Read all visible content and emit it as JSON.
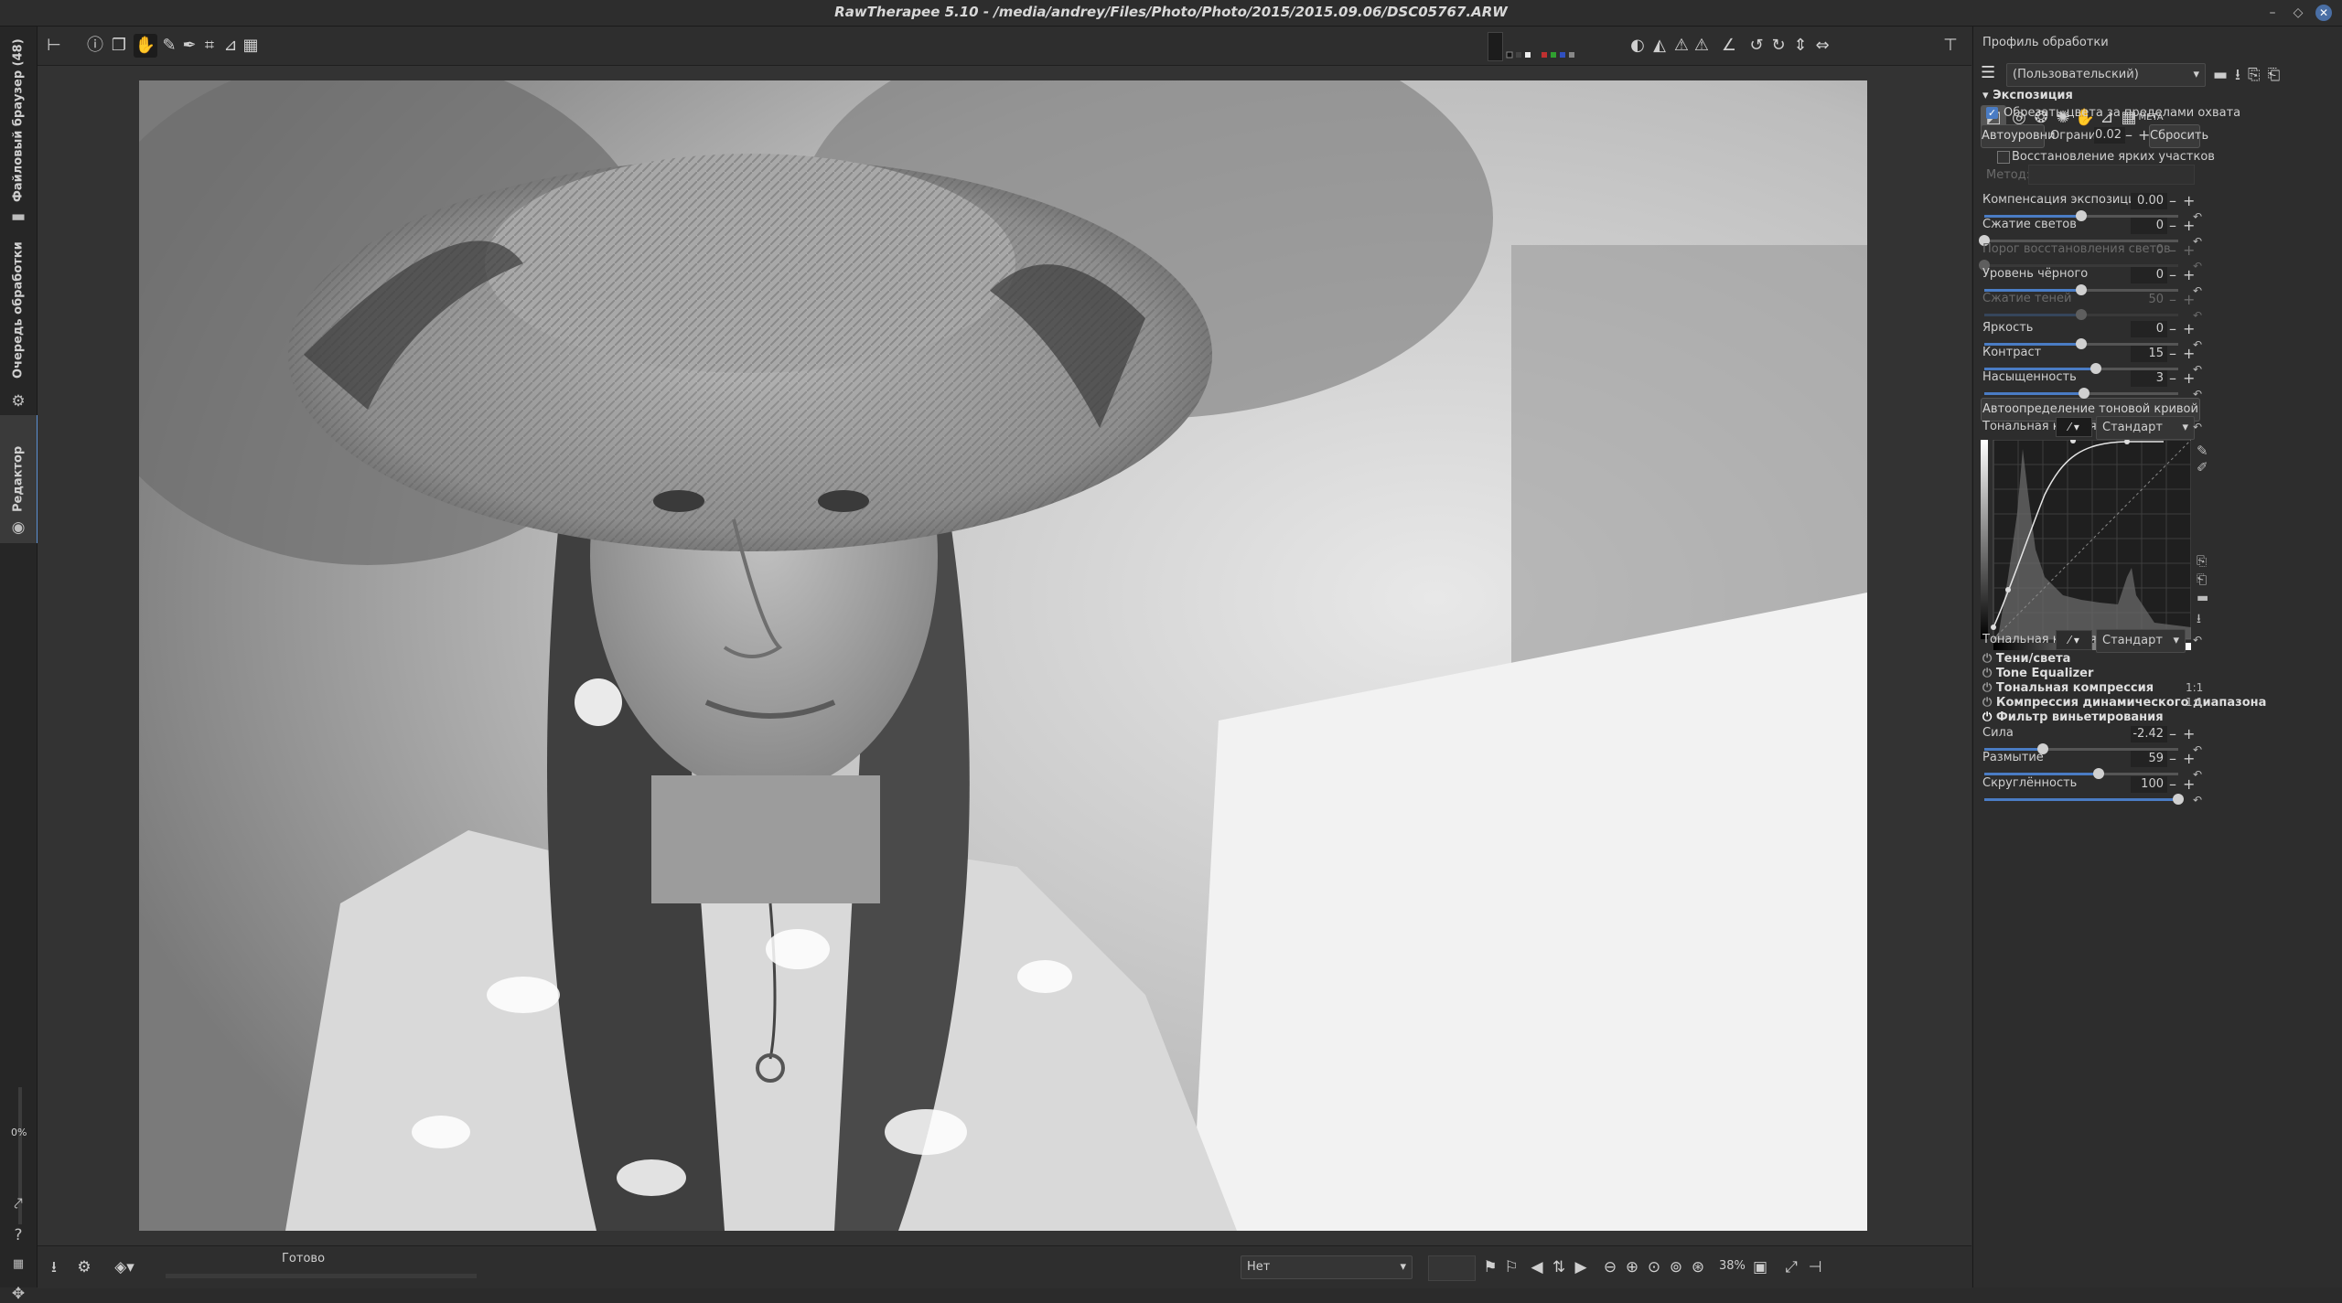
{
  "window": {
    "title": "RawTherapee 5.10 - /media/andrey/Files/Photo/Photo/2015/2015.09.06/DSC05767.ARW"
  },
  "left_tabs": {
    "file_browser": "Файловый браузер (48)",
    "queue": "Очередь обработки",
    "editor": "Редактор",
    "progress": "0%"
  },
  "status": {
    "text": "Готово",
    "zoom": "38%",
    "compare": "Нет"
  },
  "profile": {
    "title": "Профиль обработки",
    "value": "(Пользовательский)"
  },
  "exposure": {
    "title": "Экспозиция",
    "clip_label": "Обрезать цвета за пределами охвата",
    "auto_levels": "Автоуровни",
    "limit_label": "Ограничить",
    "limit_value": "0.02",
    "reset": "Сбросить",
    "highlight_recovery": "Восстановление ярких участков",
    "method_label": "Метод:",
    "sliders": [
      {
        "label": "Компенсация экспозиции",
        "value": "0.00",
        "pos": 0.5
      },
      {
        "label": "Сжатие светов",
        "value": "0",
        "pos": 0.0
      },
      {
        "label": "Порог восстановления светов",
        "value": "0",
        "pos": 0.0,
        "disabled": true
      },
      {
        "label": "Уровень чёрного",
        "value": "0",
        "pos": 0.5
      },
      {
        "label": "Сжатие теней",
        "value": "50",
        "pos": 0.5,
        "disabled": true
      },
      {
        "label": "Яркость",
        "value": "0",
        "pos": 0.5
      },
      {
        "label": "Контраст",
        "value": "15",
        "pos": 0.575
      },
      {
        "label": "Насыщенность",
        "value": "3",
        "pos": 0.515
      }
    ],
    "auto_curve": "Автоопределение тоновой кривой",
    "curve1_label": "Тональная кривая 1:",
    "curve1_mode": "Стандарт",
    "curve2_label": "Тональная кривая 2:",
    "curve2_mode": "Стандарт"
  },
  "tools": [
    {
      "label": "Тени/света"
    },
    {
      "label": "Tone Equalizer"
    },
    {
      "label": "Тональная компрессия",
      "badge": "1:1"
    },
    {
      "label": "Компрессия динамического диапазона",
      "badge": "1:1"
    },
    {
      "label": "Фильтр виньетирования"
    }
  ],
  "vignette": {
    "sliders": [
      {
        "label": "Сила",
        "value": "-2.42",
        "pos": 0.3
      },
      {
        "label": "Размытие",
        "value": "59",
        "pos": 0.59
      },
      {
        "label": "Скруглённость",
        "value": "100",
        "pos": 1.0
      }
    ]
  },
  "colors": {
    "accent": "#4a7cc4",
    "bg": "#2d2d2d"
  },
  "tab_meta": "META"
}
